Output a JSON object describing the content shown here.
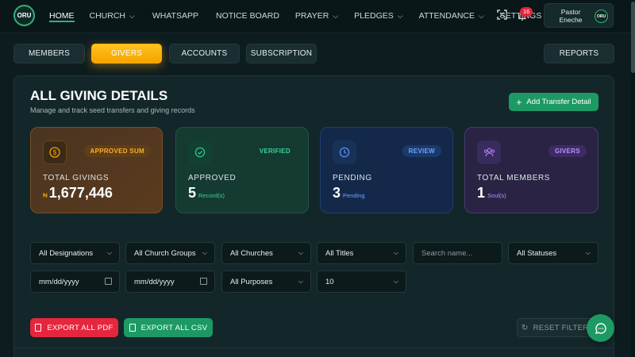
{
  "header": {
    "logo_text": "ORU",
    "nav": [
      {
        "label": "HOME",
        "active": true,
        "dropdown": false
      },
      {
        "label": "CHURCH",
        "active": false,
        "dropdown": true
      },
      {
        "label": "WHATSAPP",
        "active": false,
        "dropdown": false
      },
      {
        "label": "NOTICE BOARD",
        "active": false,
        "dropdown": false
      },
      {
        "label": "PRAYER",
        "active": false,
        "dropdown": true
      },
      {
        "label": "PLEDGES",
        "active": false,
        "dropdown": true
      },
      {
        "label": "ATTENDANCE",
        "active": false,
        "dropdown": true
      },
      {
        "label": "SETTINGS",
        "active": false,
        "dropdown": false
      }
    ],
    "icons": {
      "fullscreen": "fullscreen-icon",
      "bell": "bell-icon"
    },
    "notification_count": "16",
    "profile": {
      "name": "Pastor Eneche",
      "avatar_text": "ORU"
    }
  },
  "subtabs": [
    {
      "label": "MEMBERS",
      "active": false
    },
    {
      "label": "GIVERS",
      "active": true
    },
    {
      "label": "ACCOUNTS",
      "active": false
    },
    {
      "label": "SUBSCRIPTION",
      "active": false
    },
    {
      "label": "REPORTS",
      "active": false
    }
  ],
  "page": {
    "title": "ALL GIVING DETAILS",
    "subtitle": "Manage and track seed transfers and giving records",
    "add_button": "Add Transfer Detail"
  },
  "stats": [
    {
      "label": "TOTAL GIVINGS",
      "badge": "APPROVED SUM",
      "currency": "₦",
      "value": "1,677,446",
      "unit": "",
      "icon": "dollar-coin-icon"
    },
    {
      "label": "APPROVED",
      "badge": "VERIFIED",
      "currency": "",
      "value": "5",
      "unit": "Record(s)",
      "icon": "check-circle-icon"
    },
    {
      "label": "PENDING",
      "badge": "REVIEW",
      "currency": "",
      "value": "3",
      "unit": "Pending",
      "icon": "clock-icon"
    },
    {
      "label": "TOTAL MEMBERS",
      "badge": "GIVERS",
      "currency": "",
      "value": "1",
      "unit": "Soul(s)",
      "icon": "users-icon"
    }
  ],
  "filters": {
    "designations": "All Designations",
    "church_groups": "All Church Groups",
    "churches": "All Churches",
    "titles": "All Titles",
    "search_placeholder": "Search name...",
    "statuses": "All Statuses",
    "date_from": "mm/dd/yyyy",
    "date_to": "mm/dd/yyyy",
    "purposes": "All Purposes",
    "page_size": "10"
  },
  "actions": {
    "export_pdf": "EXPORT ALL PDF",
    "export_csv": "EXPORT ALL CSV",
    "reset": "RESET FILTERS"
  },
  "colors": {
    "accent": "#1d9a63",
    "active_tab": "#f5a300",
    "danger": "#e5263d",
    "background": "#0d1c1f"
  }
}
